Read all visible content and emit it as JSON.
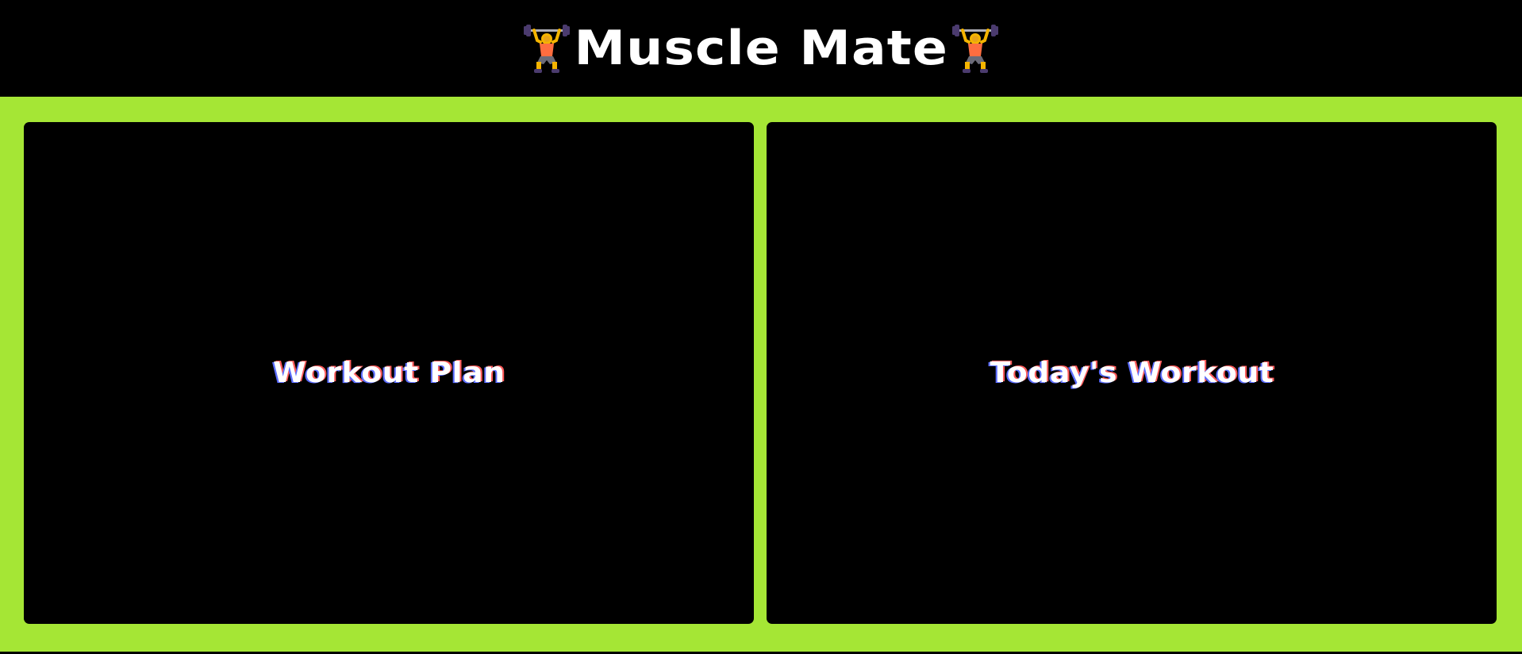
{
  "header": {
    "title": "Muscle Mate",
    "left_icon": "weight-lifter-icon",
    "right_icon": "weight-lifter-icon"
  },
  "cards": {
    "workout_plan": {
      "label": "Workout Plan"
    },
    "todays_workout": {
      "label": "Today's Workout"
    }
  },
  "colors": {
    "accent": "#a5e635",
    "background": "#000000",
    "card": "#000000",
    "text": "#ffffff"
  }
}
